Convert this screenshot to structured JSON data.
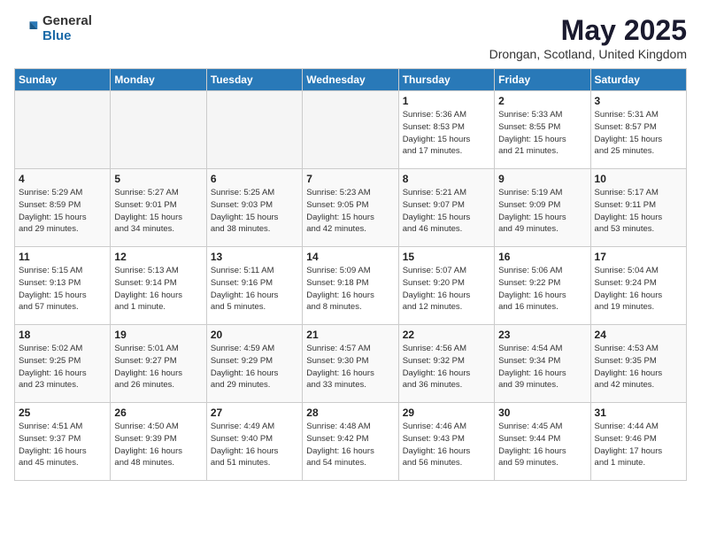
{
  "header": {
    "logo_general": "General",
    "logo_blue": "Blue",
    "month_title": "May 2025",
    "location": "Drongan, Scotland, United Kingdom"
  },
  "days_of_week": [
    "Sunday",
    "Monday",
    "Tuesday",
    "Wednesday",
    "Thursday",
    "Friday",
    "Saturday"
  ],
  "weeks": [
    [
      {
        "num": "",
        "info": ""
      },
      {
        "num": "",
        "info": ""
      },
      {
        "num": "",
        "info": ""
      },
      {
        "num": "",
        "info": ""
      },
      {
        "num": "1",
        "info": "Sunrise: 5:36 AM\nSunset: 8:53 PM\nDaylight: 15 hours\nand 17 minutes."
      },
      {
        "num": "2",
        "info": "Sunrise: 5:33 AM\nSunset: 8:55 PM\nDaylight: 15 hours\nand 21 minutes."
      },
      {
        "num": "3",
        "info": "Sunrise: 5:31 AM\nSunset: 8:57 PM\nDaylight: 15 hours\nand 25 minutes."
      }
    ],
    [
      {
        "num": "4",
        "info": "Sunrise: 5:29 AM\nSunset: 8:59 PM\nDaylight: 15 hours\nand 29 minutes."
      },
      {
        "num": "5",
        "info": "Sunrise: 5:27 AM\nSunset: 9:01 PM\nDaylight: 15 hours\nand 34 minutes."
      },
      {
        "num": "6",
        "info": "Sunrise: 5:25 AM\nSunset: 9:03 PM\nDaylight: 15 hours\nand 38 minutes."
      },
      {
        "num": "7",
        "info": "Sunrise: 5:23 AM\nSunset: 9:05 PM\nDaylight: 15 hours\nand 42 minutes."
      },
      {
        "num": "8",
        "info": "Sunrise: 5:21 AM\nSunset: 9:07 PM\nDaylight: 15 hours\nand 46 minutes."
      },
      {
        "num": "9",
        "info": "Sunrise: 5:19 AM\nSunset: 9:09 PM\nDaylight: 15 hours\nand 49 minutes."
      },
      {
        "num": "10",
        "info": "Sunrise: 5:17 AM\nSunset: 9:11 PM\nDaylight: 15 hours\nand 53 minutes."
      }
    ],
    [
      {
        "num": "11",
        "info": "Sunrise: 5:15 AM\nSunset: 9:13 PM\nDaylight: 15 hours\nand 57 minutes."
      },
      {
        "num": "12",
        "info": "Sunrise: 5:13 AM\nSunset: 9:14 PM\nDaylight: 16 hours\nand 1 minute."
      },
      {
        "num": "13",
        "info": "Sunrise: 5:11 AM\nSunset: 9:16 PM\nDaylight: 16 hours\nand 5 minutes."
      },
      {
        "num": "14",
        "info": "Sunrise: 5:09 AM\nSunset: 9:18 PM\nDaylight: 16 hours\nand 8 minutes."
      },
      {
        "num": "15",
        "info": "Sunrise: 5:07 AM\nSunset: 9:20 PM\nDaylight: 16 hours\nand 12 minutes."
      },
      {
        "num": "16",
        "info": "Sunrise: 5:06 AM\nSunset: 9:22 PM\nDaylight: 16 hours\nand 16 minutes."
      },
      {
        "num": "17",
        "info": "Sunrise: 5:04 AM\nSunset: 9:24 PM\nDaylight: 16 hours\nand 19 minutes."
      }
    ],
    [
      {
        "num": "18",
        "info": "Sunrise: 5:02 AM\nSunset: 9:25 PM\nDaylight: 16 hours\nand 23 minutes."
      },
      {
        "num": "19",
        "info": "Sunrise: 5:01 AM\nSunset: 9:27 PM\nDaylight: 16 hours\nand 26 minutes."
      },
      {
        "num": "20",
        "info": "Sunrise: 4:59 AM\nSunset: 9:29 PM\nDaylight: 16 hours\nand 29 minutes."
      },
      {
        "num": "21",
        "info": "Sunrise: 4:57 AM\nSunset: 9:30 PM\nDaylight: 16 hours\nand 33 minutes."
      },
      {
        "num": "22",
        "info": "Sunrise: 4:56 AM\nSunset: 9:32 PM\nDaylight: 16 hours\nand 36 minutes."
      },
      {
        "num": "23",
        "info": "Sunrise: 4:54 AM\nSunset: 9:34 PM\nDaylight: 16 hours\nand 39 minutes."
      },
      {
        "num": "24",
        "info": "Sunrise: 4:53 AM\nSunset: 9:35 PM\nDaylight: 16 hours\nand 42 minutes."
      }
    ],
    [
      {
        "num": "25",
        "info": "Sunrise: 4:51 AM\nSunset: 9:37 PM\nDaylight: 16 hours\nand 45 minutes."
      },
      {
        "num": "26",
        "info": "Sunrise: 4:50 AM\nSunset: 9:39 PM\nDaylight: 16 hours\nand 48 minutes."
      },
      {
        "num": "27",
        "info": "Sunrise: 4:49 AM\nSunset: 9:40 PM\nDaylight: 16 hours\nand 51 minutes."
      },
      {
        "num": "28",
        "info": "Sunrise: 4:48 AM\nSunset: 9:42 PM\nDaylight: 16 hours\nand 54 minutes."
      },
      {
        "num": "29",
        "info": "Sunrise: 4:46 AM\nSunset: 9:43 PM\nDaylight: 16 hours\nand 56 minutes."
      },
      {
        "num": "30",
        "info": "Sunrise: 4:45 AM\nSunset: 9:44 PM\nDaylight: 16 hours\nand 59 minutes."
      },
      {
        "num": "31",
        "info": "Sunrise: 4:44 AM\nSunset: 9:46 PM\nDaylight: 17 hours\nand 1 minute."
      }
    ]
  ]
}
